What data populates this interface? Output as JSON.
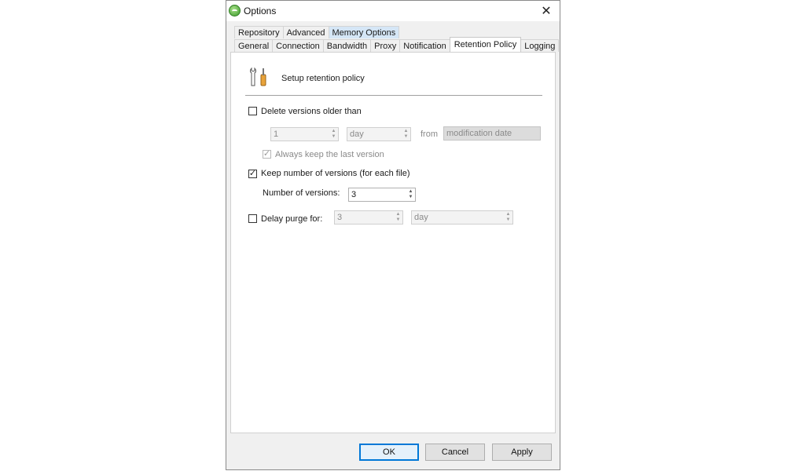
{
  "window": {
    "title": "Options",
    "close_symbol": "✕",
    "icon": "app-logo-icon"
  },
  "tabs": {
    "row1": [
      {
        "label": "Repository"
      },
      {
        "label": "Advanced"
      },
      {
        "label": "Memory Options"
      }
    ],
    "row2": [
      {
        "label": "General"
      },
      {
        "label": "Connection"
      },
      {
        "label": "Bandwidth"
      },
      {
        "label": "Proxy"
      },
      {
        "label": "Notification"
      },
      {
        "label": "Retention Policy"
      },
      {
        "label": "Logging"
      }
    ],
    "active": "Retention Policy"
  },
  "header": {
    "icon": "tools-icon",
    "label": "Setup retention policy"
  },
  "delete_versions": {
    "label": "Delete versions older than",
    "checked": false,
    "amount": "1",
    "unit": "day",
    "from_label": "from",
    "from_value": "modification date",
    "always_keep": {
      "label": "Always keep the last version",
      "checked": true,
      "disabled": true
    }
  },
  "keep_versions": {
    "label": "Keep number of versions (for each file)",
    "checked": true,
    "count_label": "Number of versions:",
    "count_value": "3"
  },
  "delay_purge": {
    "label": "Delay purge for:",
    "checked": false,
    "amount": "3",
    "unit": "day"
  },
  "buttons": {
    "ok": "OK",
    "cancel": "Cancel",
    "apply": "Apply"
  },
  "colors": {
    "accent": "#0078d7",
    "tab_highlight": "#d5e6f6",
    "disabled_text": "#8a8a8a"
  },
  "glyphs": {
    "check": "✓",
    "up": "▲",
    "down": "▼"
  }
}
